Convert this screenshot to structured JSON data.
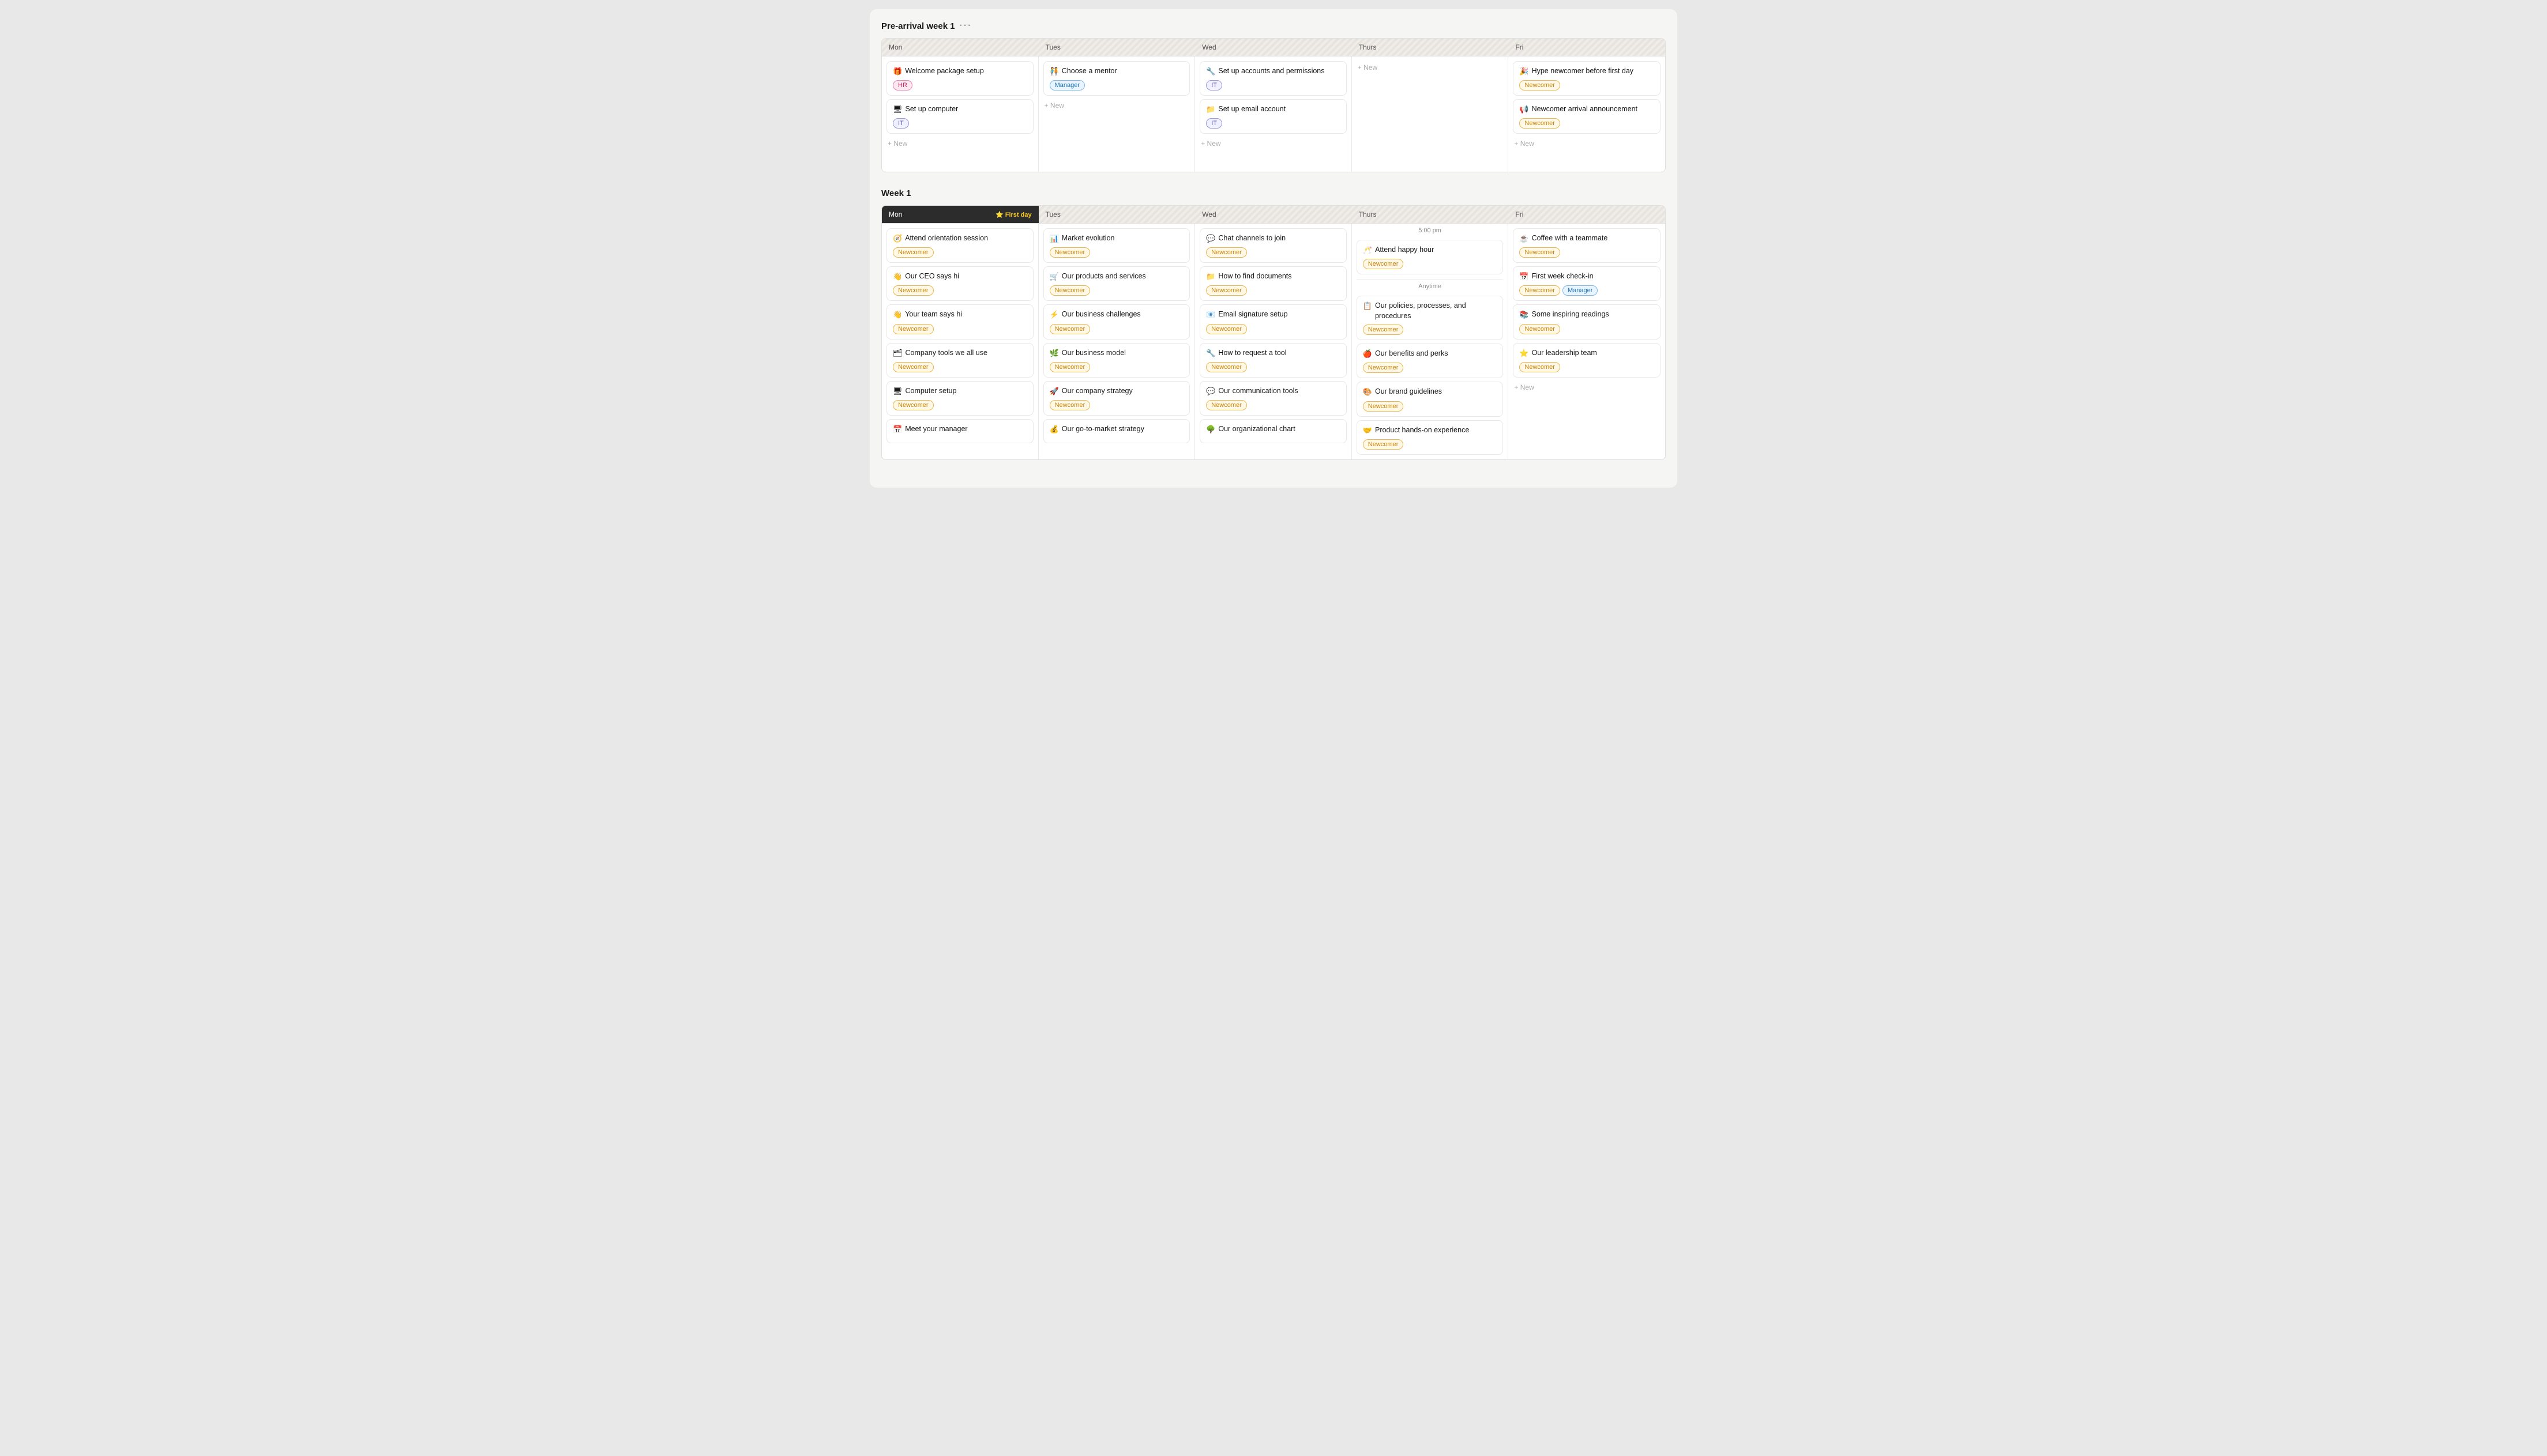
{
  "pre_arrival": {
    "title": "Pre-arrival week 1",
    "dots": "···",
    "days": [
      "Mon",
      "Tues",
      "Wed",
      "Thurs",
      "Fri"
    ],
    "columns": [
      {
        "day": "Mon",
        "cards": [
          {
            "emoji": "🎁",
            "title": "Welcome package setup",
            "tags": [
              {
                "label": "HR",
                "type": "hr"
              }
            ]
          },
          {
            "emoji": "🖥",
            "title": "Set up computer",
            "tags": [
              {
                "label": "IT",
                "type": "it"
              }
            ]
          }
        ]
      },
      {
        "day": "Tues",
        "cards": [
          {
            "emoji": "🧑‍🤝‍🧑",
            "title": "Choose a mentor",
            "tags": [
              {
                "label": "Manager",
                "type": "manager"
              }
            ]
          }
        ]
      },
      {
        "day": "Wed",
        "cards": [
          {
            "emoji": "🔧",
            "title": "Set up accounts and permissions",
            "tags": [
              {
                "label": "IT",
                "type": "it"
              }
            ]
          },
          {
            "emoji": "📁",
            "title": "Set up email account",
            "tags": [
              {
                "label": "IT",
                "type": "it"
              }
            ]
          }
        ]
      },
      {
        "day": "Thurs",
        "cards": []
      },
      {
        "day": "Fri",
        "cards": [
          {
            "emoji": "🎉",
            "title": "Hype newcomer before first day",
            "tags": [
              {
                "label": "Newcomer",
                "type": "newcomer"
              }
            ]
          },
          {
            "emoji": "📢",
            "title": "Newcomer arrival announcement",
            "tags": [
              {
                "label": "Newcomer",
                "type": "newcomer"
              }
            ]
          }
        ]
      }
    ]
  },
  "week1": {
    "title": "Week 1",
    "days": [
      "Mon",
      "Tues",
      "Wed",
      "Thurs",
      "Fri"
    ],
    "columns": [
      {
        "day": "Mon",
        "first_day": true,
        "cards": [
          {
            "emoji": "🧭",
            "title": "Attend orientation session",
            "tags": [
              {
                "label": "Newcomer",
                "type": "newcomer"
              }
            ]
          },
          {
            "emoji": "👋",
            "title": "Our CEO says hi",
            "tags": [
              {
                "label": "Newcomer",
                "type": "newcomer"
              }
            ]
          },
          {
            "emoji": "👋",
            "title": "Your team says hi",
            "tags": [
              {
                "label": "Newcomer",
                "type": "newcomer"
              }
            ]
          },
          {
            "emoji": "🗂",
            "title": "Company tools we all use",
            "tags": [
              {
                "label": "Newcomer",
                "type": "newcomer"
              }
            ]
          },
          {
            "emoji": "🖥",
            "title": "Computer setup",
            "tags": [
              {
                "label": "Newcomer",
                "type": "newcomer"
              }
            ]
          },
          {
            "emoji": "📅",
            "title": "Meet your manager",
            "tags": []
          }
        ]
      },
      {
        "day": "Tues",
        "cards": [
          {
            "emoji": "📊",
            "title": "Market evolution",
            "tags": [
              {
                "label": "Newcomer",
                "type": "newcomer"
              }
            ]
          },
          {
            "emoji": "🛒",
            "title": "Our products and services",
            "tags": [
              {
                "label": "Newcomer",
                "type": "newcomer"
              }
            ]
          },
          {
            "emoji": "⚡",
            "title": "Our business challenges",
            "tags": [
              {
                "label": "Newcomer",
                "type": "newcomer"
              }
            ]
          },
          {
            "emoji": "🌿",
            "title": "Our business model",
            "tags": [
              {
                "label": "Newcomer",
                "type": "newcomer"
              }
            ]
          },
          {
            "emoji": "🚀",
            "title": "Our company strategy",
            "tags": [
              {
                "label": "Newcomer",
                "type": "newcomer"
              }
            ]
          },
          {
            "emoji": "💰",
            "title": "Our go-to-market strategy",
            "tags": []
          }
        ]
      },
      {
        "day": "Wed",
        "cards": [
          {
            "emoji": "💬",
            "title": "Chat channels to join",
            "tags": [
              {
                "label": "Newcomer",
                "type": "newcomer"
              }
            ]
          },
          {
            "emoji": "📁",
            "title": "How to find documents",
            "tags": [
              {
                "label": "Newcomer",
                "type": "newcomer"
              }
            ]
          },
          {
            "emoji": "📧",
            "title": "Email signature setup",
            "tags": [
              {
                "label": "Newcomer",
                "type": "newcomer"
              }
            ]
          },
          {
            "emoji": "🔧",
            "title": "How to request a tool",
            "tags": [
              {
                "label": "Newcomer",
                "type": "newcomer"
              }
            ]
          },
          {
            "emoji": "💬",
            "title": "Our communication tools",
            "tags": [
              {
                "label": "Newcomer",
                "type": "newcomer"
              }
            ]
          },
          {
            "emoji": "🌳",
            "title": "Our organizational chart",
            "tags": []
          }
        ]
      },
      {
        "day": "Thurs",
        "time_sections": [
          {
            "time": "5:00 pm",
            "cards": [
              {
                "emoji": "🥂",
                "title": "Attend happy hour",
                "tags": [
                  {
                    "label": "Newcomer",
                    "type": "newcomer"
                  }
                ]
              }
            ]
          },
          {
            "time": "Anytime",
            "cards": [
              {
                "emoji": "📋",
                "title": "Our policies, processes, and procedures",
                "tags": [
                  {
                    "label": "Newcomer",
                    "type": "newcomer"
                  }
                ]
              },
              {
                "emoji": "🍎",
                "title": "Our benefits and perks",
                "tags": [
                  {
                    "label": "Newcomer",
                    "type": "newcomer"
                  }
                ]
              },
              {
                "emoji": "🎨",
                "title": "Our brand guidelines",
                "tags": [
                  {
                    "label": "Newcomer",
                    "type": "newcomer"
                  }
                ]
              },
              {
                "emoji": "🤝",
                "title": "Product hands-on experience",
                "tags": [
                  {
                    "label": "Newcomer",
                    "type": "newcomer"
                  }
                ]
              }
            ]
          }
        ]
      },
      {
        "day": "Fri",
        "cards": [
          {
            "emoji": "☕",
            "title": "Coffee with a teammate",
            "tags": [
              {
                "label": "Newcomer",
                "type": "newcomer"
              }
            ]
          },
          {
            "emoji": "📅",
            "title": "First week check-in",
            "tags": [
              {
                "label": "Newcomer",
                "type": "newcomer"
              },
              {
                "label": "Manager",
                "type": "manager"
              }
            ]
          },
          {
            "emoji": "📚",
            "title": "Some inspiring readings",
            "tags": [
              {
                "label": "Newcomer",
                "type": "newcomer"
              }
            ]
          },
          {
            "emoji": "⭐",
            "title": "Our leadership team",
            "tags": [
              {
                "label": "Newcomer",
                "type": "newcomer"
              }
            ]
          }
        ]
      }
    ]
  },
  "labels": {
    "new": "+ New",
    "first_day": "⭐ First day"
  }
}
